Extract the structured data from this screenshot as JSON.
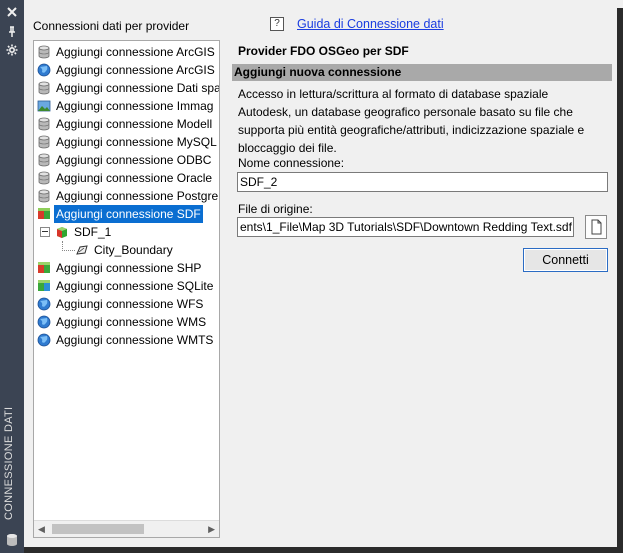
{
  "sidebar_strip": {
    "title": "CONNESSIONE DATI",
    "icons": [
      "close-icon",
      "pin-icon",
      "settings-icon",
      "database-icon"
    ]
  },
  "panel": {
    "title": "Connessioni dati per provider",
    "help_link": "Guida di Connessione dati",
    "help_icon_glyph": "?"
  },
  "tree": {
    "items": [
      {
        "label": "Aggiungi connessione ArcGIS",
        "icon": "database-icon",
        "indent": 0
      },
      {
        "label": "Aggiungi connessione ArcGIS",
        "icon": "globe-icon",
        "indent": 0
      },
      {
        "label": "Aggiungi connessione Dati spa",
        "icon": "database-icon",
        "indent": 0
      },
      {
        "label": "Aggiungi connessione Immag",
        "icon": "image-icon",
        "indent": 0
      },
      {
        "label": "Aggiungi connessione Modell",
        "icon": "database-icon",
        "indent": 0
      },
      {
        "label": "Aggiungi connessione MySQL",
        "icon": "database-icon",
        "indent": 0
      },
      {
        "label": "Aggiungi connessione ODBC",
        "icon": "database-icon",
        "indent": 0
      },
      {
        "label": "Aggiungi connessione Oracle",
        "icon": "database-icon",
        "indent": 0
      },
      {
        "label": "Aggiungi connessione Postgre",
        "icon": "database-icon",
        "indent": 0
      },
      {
        "label": "Aggiungi connessione SDF",
        "icon": "sdf-icon",
        "indent": 0,
        "selected": true
      },
      {
        "label": "SDF_1",
        "icon": "sdf-cube-icon",
        "indent": 1
      },
      {
        "label": "City_Boundary",
        "icon": "polygon-layer-icon",
        "indent": 2
      },
      {
        "label": "Aggiungi connessione SHP",
        "icon": "shp-icon",
        "indent": 0
      },
      {
        "label": "Aggiungi connessione SQLite",
        "icon": "sqlite-icon",
        "indent": 0
      },
      {
        "label": "Aggiungi connessione WFS",
        "icon": "globe-icon",
        "indent": 0
      },
      {
        "label": "Aggiungi connessione WMS",
        "icon": "globe-icon",
        "indent": 0
      },
      {
        "label": "Aggiungi connessione WMTS",
        "icon": "globe-icon",
        "indent": 0
      }
    ]
  },
  "content": {
    "provider_title": "Provider FDO OSGeo per SDF",
    "section_title": "Aggiungi nuova connessione",
    "description": [
      "Accesso in lettura/scrittura al formato di database spaziale",
      "Autodesk, un database geografico personale basato su file che",
      "supporta più entità geografiche/attributi, indicizzazione spaziale e",
      "bloccaggio dei file."
    ],
    "connection_name_label": "Nome connessione:",
    "connection_name_value": "SDF_2",
    "source_file_label": "File di origine:",
    "source_file_value": "ents\\1_File\\Map 3D Tutorials\\SDF\\Downtown Redding Text.sdf",
    "connect_button": "Connetti"
  },
  "colors": {
    "strip": "#3b4453",
    "selection": "#0a6ed1",
    "link": "#1a3de0",
    "section_bar": "#a9a9a9"
  }
}
